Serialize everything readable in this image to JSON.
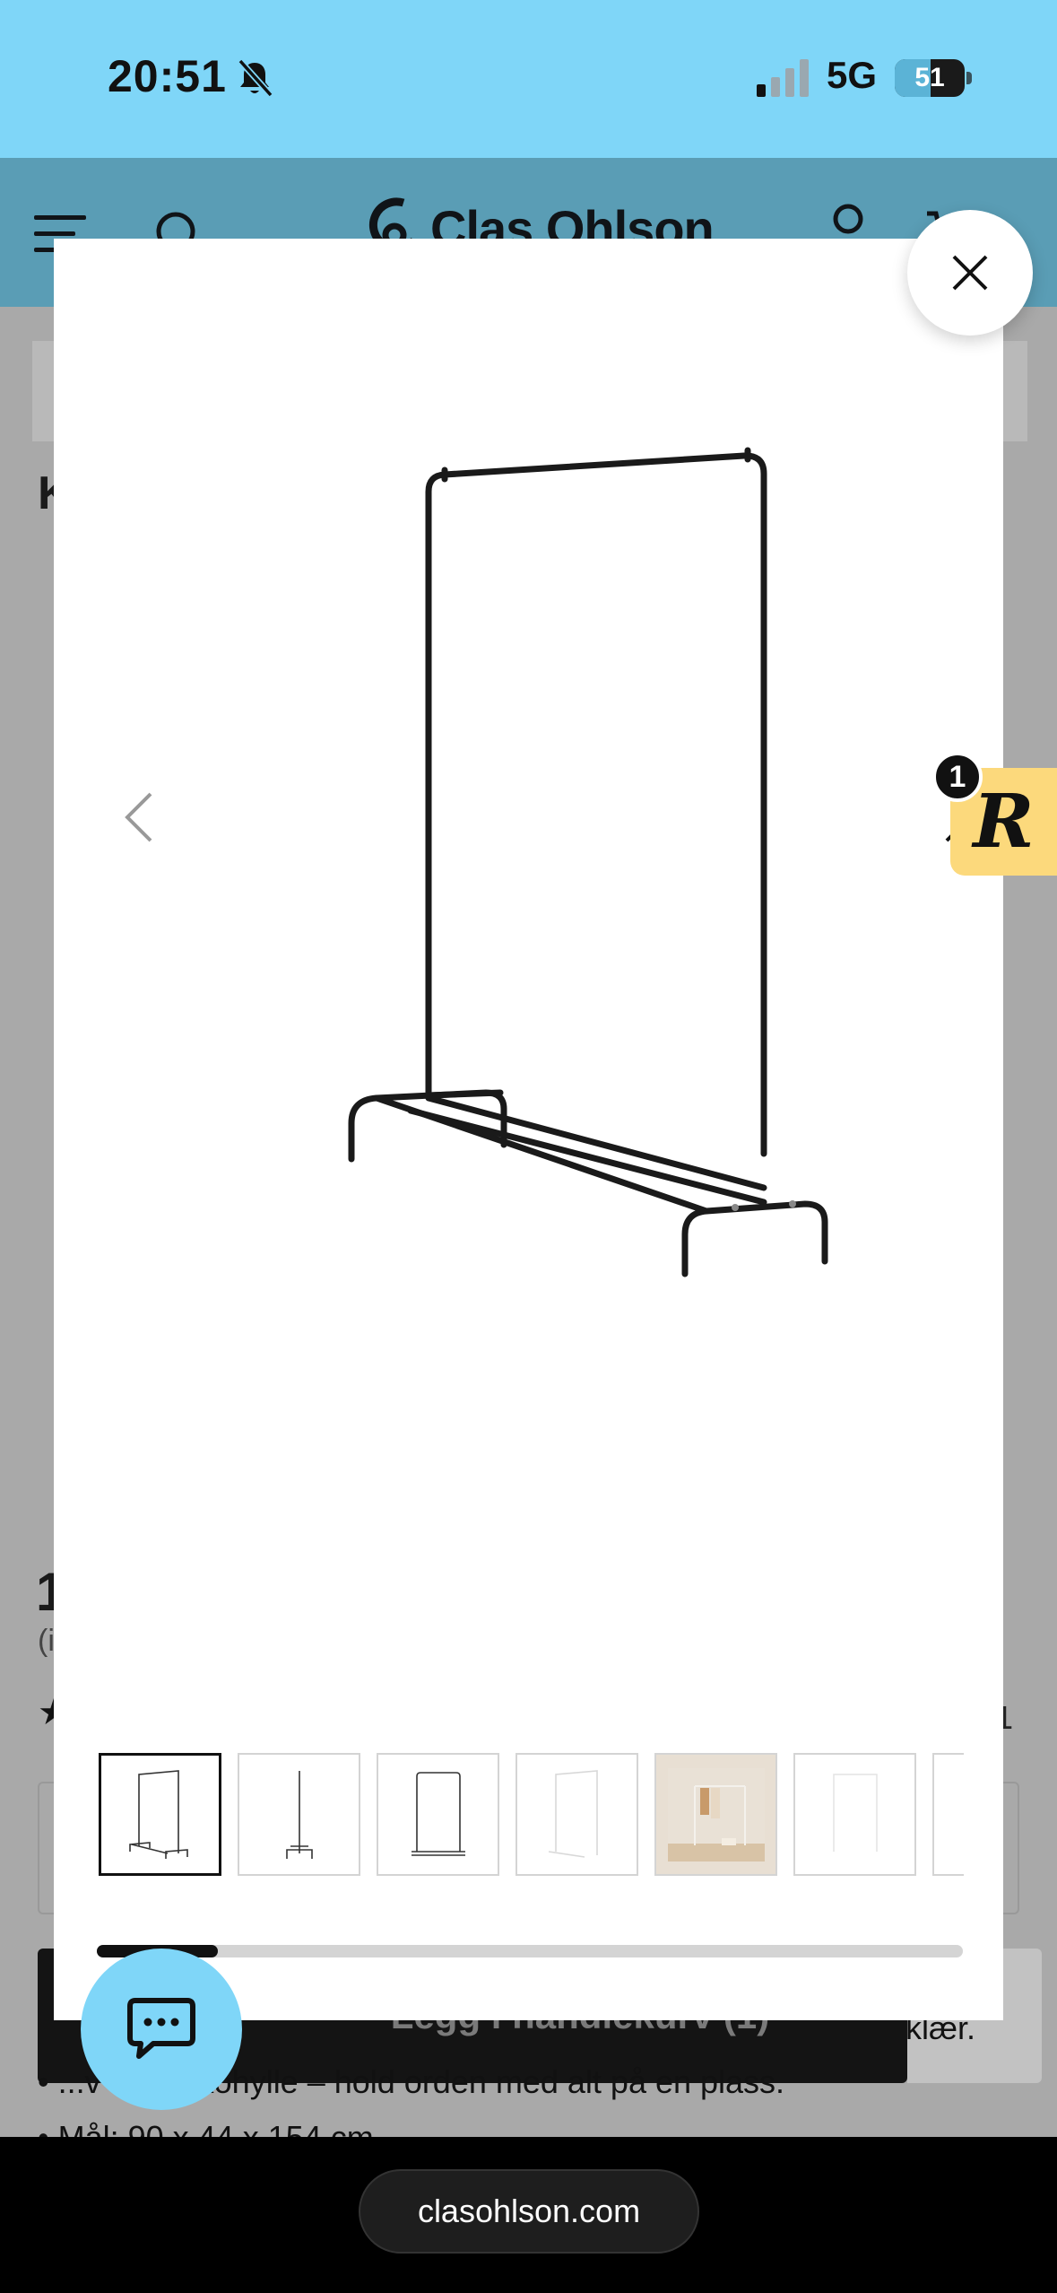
{
  "status_bar": {
    "time": "20:51",
    "network": "5G",
    "battery_level": "51",
    "icons": [
      "bell-slash-icon",
      "signal-icon",
      "battery-icon"
    ]
  },
  "header": {
    "logo_text": "Clas Ohlson",
    "icons": [
      "menu-icon",
      "search-icon",
      "account-icon",
      "cart-icon"
    ]
  },
  "background_page": {
    "title_partial": "K",
    "price_partial": "1",
    "vat_partial": "(i",
    "rating_star": "★",
    "review_count_partial": "1",
    "add_to_cart_label": "Legg i handlekurv (1)",
    "cta_trail_text": "klær.",
    "bullet_1": "• ...v med skohylle – hold orden med alt på en plass.",
    "bullet_2": "• Mål: 90 x 44 x 154 cm"
  },
  "gallery_modal": {
    "main_image_alt": "Black metal clothes rack",
    "thumbnails": [
      {
        "kind": "rack-front",
        "active": true
      },
      {
        "kind": "rack-side",
        "active": false
      },
      {
        "kind": "rack-front-small",
        "active": false
      },
      {
        "kind": "rack-faint",
        "active": false
      },
      {
        "kind": "lifestyle-photo",
        "active": false
      },
      {
        "kind": "rack-faint",
        "active": false
      },
      {
        "kind": "partial",
        "active": false
      }
    ],
    "scroll_progress": 0.14,
    "icons": [
      "close-icon",
      "chevron-left-icon",
      "chevron-right-icon"
    ]
  },
  "reward_widget": {
    "letter": "R",
    "badge_count": "1"
  },
  "chat_widget": {
    "icon": "chat-icon"
  },
  "browser": {
    "url": "clasohlson.com"
  },
  "colors": {
    "status_bar_bg": "#7fd6f8",
    "header_bg": "#5a9db5",
    "reward_bg": "#fcd97c",
    "chat_bg": "#7fd6f8"
  }
}
